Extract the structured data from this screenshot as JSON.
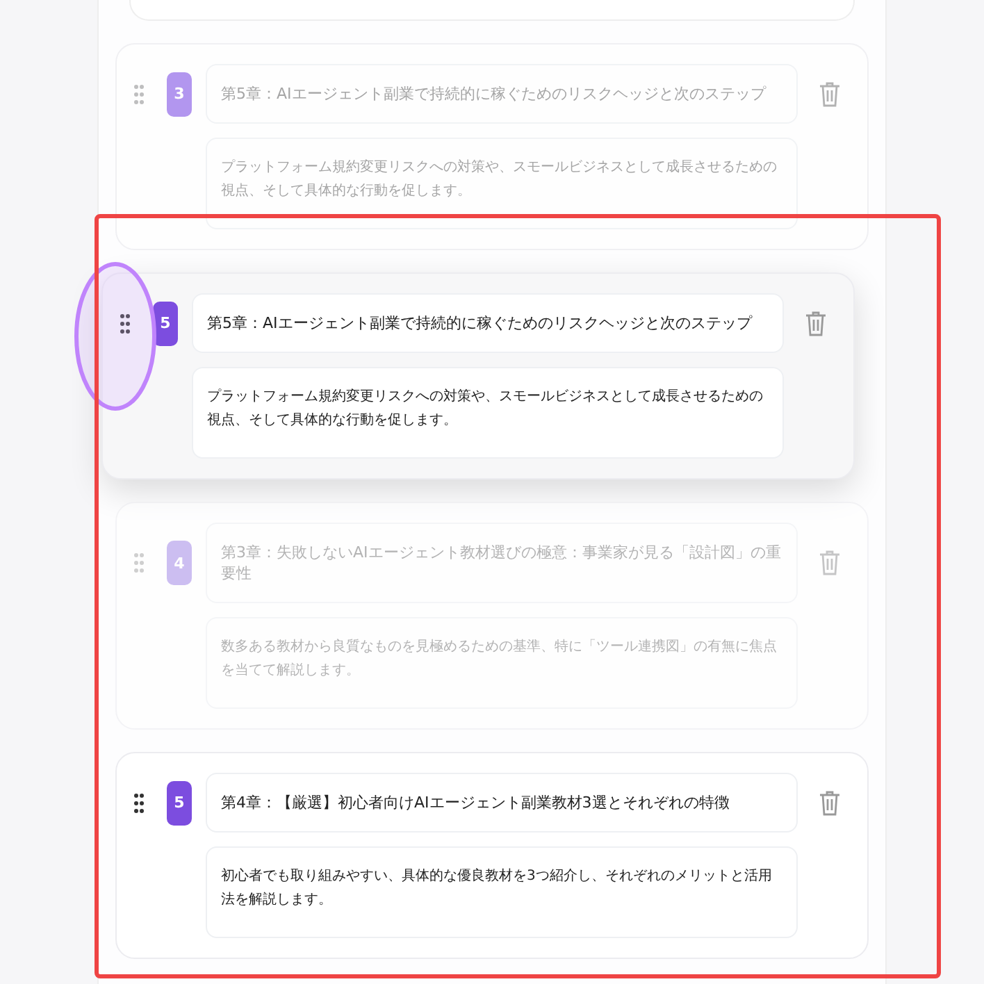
{
  "chapters": [
    {
      "number": "3",
      "title": "第5章：AIエージェント副業で持続的に稼ぐためのリスクヘッジと次のステップ",
      "description": "プラットフォーム規約変更リスクへの対策や、スモールビジネスとして成長させるための視点、そして具体的な行動を促します。",
      "kind": "ghost"
    },
    {
      "number": "5",
      "title": "第5章：AIエージェント副業で持続的に稼ぐためのリスクヘッジと次のステップ",
      "description": "プラットフォーム規約変更リスクへの対策や、スモールビジネスとして成長させるための視点、そして具体的な行動を促します。",
      "kind": "dragging"
    },
    {
      "number": "4",
      "title": "第3章：失敗しないAIエージェント教材選びの極意：事業家が見る「設計図」の重要性",
      "description": "数多ある教材から良質なものを見極めるための基準、特に「ツール連携図」の有無に焦点を当てて解説します。",
      "kind": "faded"
    },
    {
      "number": "5",
      "title": "第4章：【厳選】初心者向けAIエージェント副業教材3選とそれぞれの特徴",
      "description": "初心者でも取り組みやすい、具体的な優良教材を3つ紹介し、それぞれのメリットと活用法を解説します。",
      "kind": "normal"
    }
  ],
  "highlight": {
    "on": true
  }
}
